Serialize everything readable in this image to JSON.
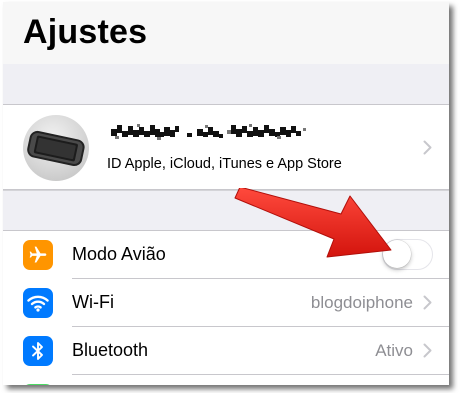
{
  "header": {
    "title": "Ajustes"
  },
  "account": {
    "name_redacted": "",
    "subtitle": "ID Apple, iCloud, iTunes e App Store"
  },
  "settings": [
    {
      "id": "airplane",
      "label": "Modo Avião",
      "icon": "airplane-icon",
      "icon_color": "#ff9500",
      "toggle": "off"
    },
    {
      "id": "wifi",
      "label": "Wi-Fi",
      "value": "blogdoiphone",
      "icon": "wifi-icon",
      "icon_color": "#007aff"
    },
    {
      "id": "bluetooth",
      "label": "Bluetooth",
      "value": "Ativo",
      "icon": "bluetooth-icon",
      "icon_color": "#007aff"
    },
    {
      "id": "partial",
      "icon_color": "#4cd964"
    }
  ],
  "annotation": {
    "type": "arrow",
    "color": "#e8251d",
    "points_to": "airplane-toggle"
  },
  "colors": {
    "chevron": "#c7c7cc",
    "value_text": "#8e8e93",
    "background": "#efeff4"
  }
}
